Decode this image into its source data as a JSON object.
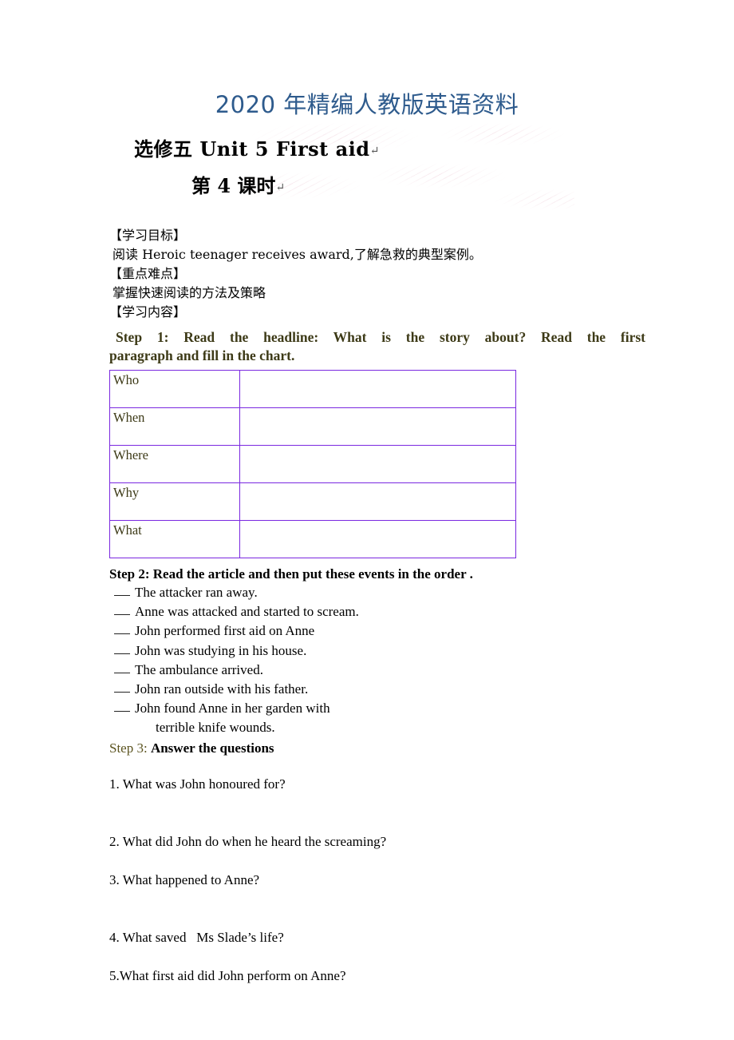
{
  "header": {
    "banner": "2020 年精编人教版英语资料"
  },
  "title": {
    "main": "选修五  Unit 5 First aid",
    "sub": "第 4 课时",
    "pilcrow": "↵"
  },
  "sections": {
    "objective_heading": "【学习目标】",
    "objective_text": "阅读 Heroic teenager receives award,了解急救的典型案例。",
    "keypoint_heading": "【重点难点】",
    "keypoint_text": "掌握快速阅读的方法及策略",
    "content_heading": "【学习内容】"
  },
  "step1": {
    "line1": "Step 1:    Read  the  headline:  What  is  the  story  about?    Read  the  first",
    "line2": "paragraph and fill in the chart.",
    "color": "#3d3a17"
  },
  "chart_table": {
    "border_color": "#7a28e0",
    "label_color": "#3d3a17",
    "rows": [
      {
        "label": "Who",
        "value": ""
      },
      {
        "label": "When",
        "value": ""
      },
      {
        "label": "Where",
        "value": ""
      },
      {
        "label": "Why",
        "value": ""
      },
      {
        "label": "What",
        "value": ""
      }
    ]
  },
  "step2": {
    "heading": "Step 2: Read the article and then put these events in the order .",
    "events": [
      "The attacker ran away.",
      "Anne was attacked and started to scream.",
      "John performed first aid on Anne",
      "John was studying in his house.",
      "The ambulance arrived.",
      "John ran outside with his father.",
      "John found Anne in her garden with"
    ],
    "event_continuation": "terrible knife wounds."
  },
  "step3": {
    "label": "Step 3: ",
    "text": "Answer the questions",
    "label_color": "#5c5420",
    "questions": [
      "1. What was John honoured for?",
      "2. What did John do when he heard the screaming?",
      "3. What happened to Anne?",
      "4. What saved   Ms Slade’s life?",
      "5.What first aid did John perform on Anne?"
    ]
  }
}
